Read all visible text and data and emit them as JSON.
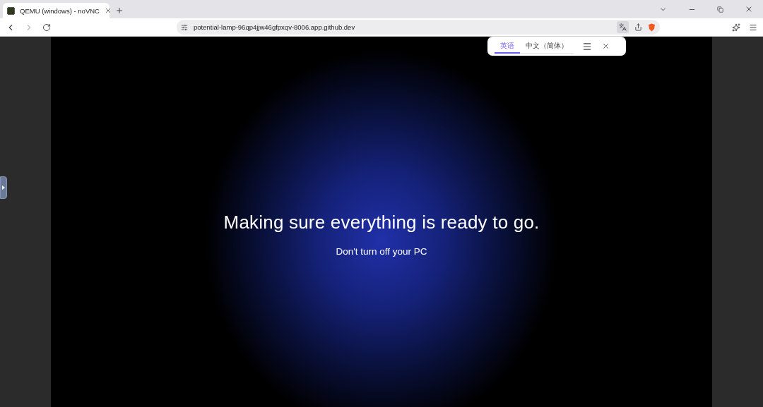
{
  "browser": {
    "tabs": [
      {
        "title": "QEMU (windows) - noVNC",
        "selected": true
      }
    ],
    "address": "potential-lamp-96qp4jjw46gfpxqv-8006.app.github.dev",
    "translate_popup": {
      "languages": [
        {
          "label": "英语",
          "selected": true
        },
        {
          "label": "中文（简体）",
          "selected": false
        }
      ]
    }
  },
  "remote_screen": {
    "heading": "Making sure everything is ready to go.",
    "subheading": "Don't turn off your PC"
  }
}
